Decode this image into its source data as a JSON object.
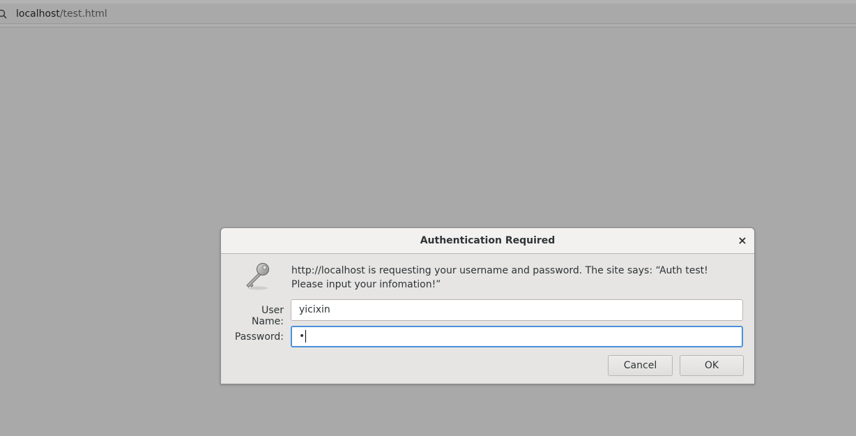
{
  "browser": {
    "url_host": "localhost",
    "url_path": "/test.html"
  },
  "dialog": {
    "title": "Authentication Required",
    "close_symbol": "×",
    "message": "http://localhost is requesting your username and password. The site says: “Auth test! Please input your infomation!”",
    "username_label": "User Name:",
    "username_value": "yicixin",
    "password_label": "Password:",
    "password_mask": "•",
    "cancel_label": "Cancel",
    "ok_label": "OK"
  },
  "icons": {
    "url": "search-icon",
    "dialog": "key-icon",
    "close": "close-icon"
  },
  "colors": {
    "page_background": "#a9a9a9",
    "dialog_background": "#e6e5e4",
    "focus_ring": "#4a90d9"
  }
}
